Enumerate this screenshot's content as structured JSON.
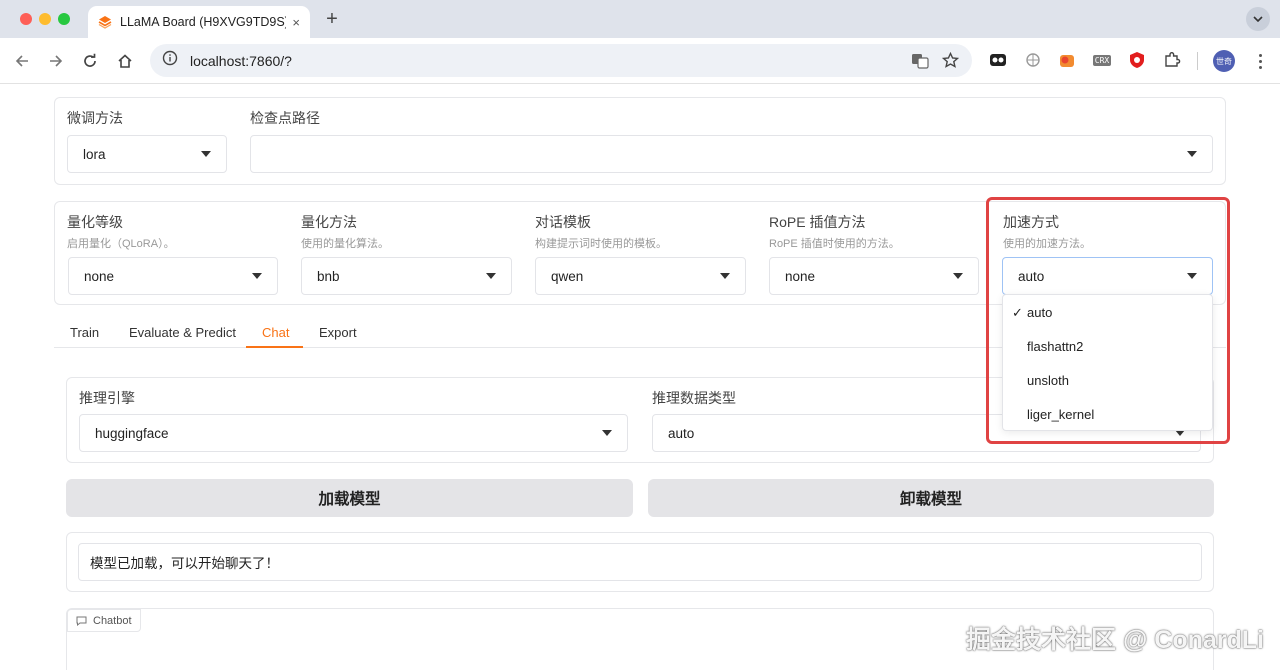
{
  "browser": {
    "tab_title": "LLaMA Board (H9XVG9TD9S)",
    "tab_close": "×",
    "new_tab": "+",
    "url": "localhost:7860/?",
    "avatar_text": "世奇",
    "crx_label": "CRX"
  },
  "top_panel": {
    "finetune_label": "微调方法",
    "finetune_value": "lora",
    "checkpoint_label": "检查点路径",
    "checkpoint_value": ""
  },
  "settings": [
    {
      "label": "量化等级",
      "info": "启用量化（QLoRA）。",
      "value": "none"
    },
    {
      "label": "量化方法",
      "info": "使用的量化算法。",
      "value": "bnb"
    },
    {
      "label": "对话模板",
      "info": "构建提示词时使用的模板。",
      "value": "qwen"
    },
    {
      "label": "RoPE 插值方法",
      "info": "RoPE 插值时使用的方法。",
      "value": "none"
    },
    {
      "label": "加速方式",
      "info": "使用的加速方法。",
      "value": "auto"
    }
  ],
  "accel_menu": {
    "check": "✓",
    "options": [
      "auto",
      "flashattn2",
      "unsloth",
      "liger_kernel"
    ]
  },
  "tabs": [
    "Train",
    "Evaluate & Predict",
    "Chat",
    "Export"
  ],
  "chat": {
    "engine_label": "推理引擎",
    "engine_value": "huggingface",
    "dtype_label": "推理数据类型",
    "dtype_value": "auto",
    "load_button": "加载模型",
    "unload_button": "卸载模型",
    "status_text": "模型已加载，可以开始聊天了！",
    "chatbot_label": "Chatbot"
  },
  "watermark": "掘金技术社区 @ ConardLi",
  "colors": {
    "accent": "#f97316",
    "highlight": "#e04343"
  }
}
